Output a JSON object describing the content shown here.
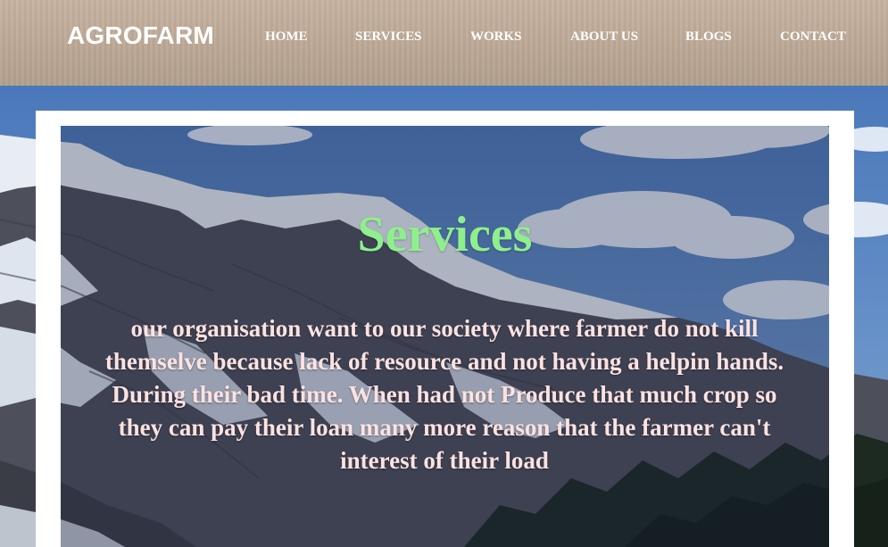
{
  "header": {
    "brand": "AGROFARM",
    "nav": {
      "home": "HOME",
      "services": "SERVICES",
      "works": "WORKS",
      "about": "ABOUT US",
      "blogs": "BLOGS",
      "contact": "CONTACT"
    }
  },
  "main": {
    "title": "Services",
    "description": "our organisation want to our society where farmer do not kill themselve because lack of resource and not having a helpin hands. During their bad time. When had not Produce that much crop so they can pay their loan many more reason that the farmer can't interest of their load"
  },
  "colors": {
    "header_bg": "#bca895",
    "title": "#8ef08c",
    "description_text": "#fde2e0",
    "nav_text": "#ffffff"
  }
}
